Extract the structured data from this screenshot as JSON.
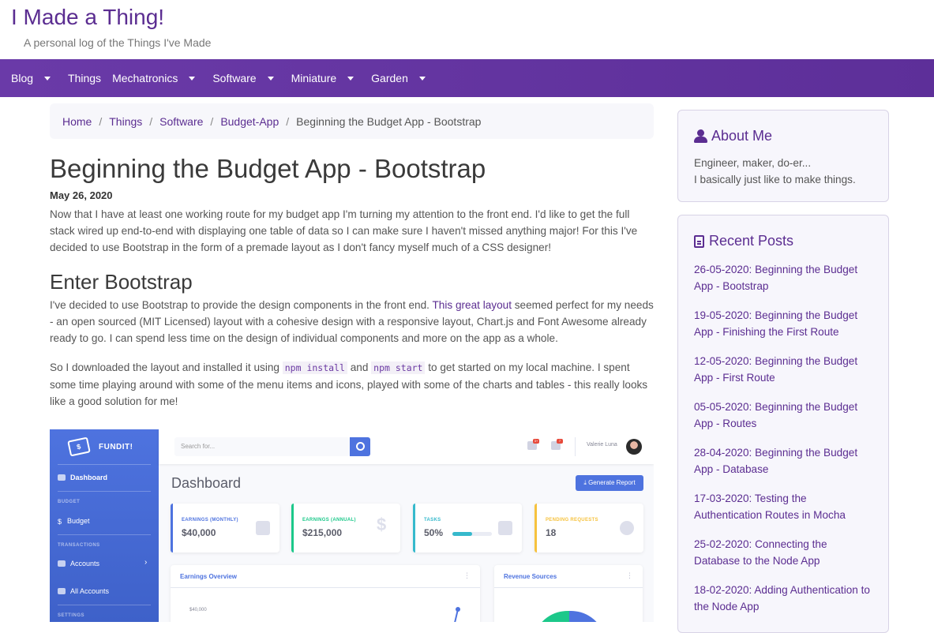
{
  "site": {
    "title": "I Made a Thing!",
    "tagline": "A personal log of the Things I've Made"
  },
  "nav": {
    "items": [
      {
        "label": "Blog",
        "dropdown": true
      },
      {
        "label": "Things",
        "dropdown": false
      },
      {
        "label": "Mechatronics",
        "dropdown": true
      },
      {
        "label": "Software",
        "dropdown": true
      },
      {
        "label": "Miniature",
        "dropdown": true
      },
      {
        "label": "Garden",
        "dropdown": true
      }
    ]
  },
  "breadcrumb": {
    "items": [
      "Home",
      "Things",
      "Software",
      "Budget-App"
    ],
    "current": "Beginning the Budget App - Bootstrap",
    "separator": "/"
  },
  "post": {
    "title": "Beginning the Budget App - Bootstrap",
    "date": "May 26, 2020",
    "intro": "Now that I have at least one working route for my budget app I'm turning my attention to the front end. I'd like to get the full stack wired up end-to-end with displaying one table of data so I can make sure I haven't missed anything major! For this I've decided to use Bootstrap in the form of a premade layout as I don't fancy myself much of a CSS designer!",
    "section_heading": "Enter Bootstrap",
    "p1_before": "I've decided to use Bootstrap to provide the design components in the front end. ",
    "p1_link": "This great layout",
    "p1_after": " seemed perfect for my needs - an open sourced (MIT Licensed) layout with a cohesive design with a responsive layout, Chart.js and Font Awesome already ready to go. I can spend less time on the design of individual components and more on the app as a whole.",
    "p2_a": "So I downloaded the layout and installed it using ",
    "p2_code1": "npm install",
    "p2_b": " and ",
    "p2_code2": "npm start",
    "p2_c": " to get started on my local machine. I spent some time playing around with some of the menu items and icons, played with some of the charts and tables - this really looks like a good solution for me!"
  },
  "screenshot": {
    "brand": "FUNDIT!",
    "sidebar": {
      "dashboard": "Dashboard",
      "sec_budget": "BUDGET",
      "budget": "Budget",
      "sec_transactions": "TRANSACTIONS",
      "accounts": "Accounts",
      "all_accounts": "All Accounts",
      "sec_settings": "SETTINGS"
    },
    "search_placeholder": "Search for...",
    "user": "Valerie Luna",
    "badge1": "3+",
    "badge2": "7",
    "page_title": "Dashboard",
    "report_button": "Generate Report",
    "cards": [
      {
        "label": "EARNINGS (MONTHLY)",
        "value": "$40,000",
        "color": "#4e73df"
      },
      {
        "label": "EARNINGS (ANNUAL)",
        "value": "$215,000",
        "color": "#1cc88a"
      },
      {
        "label": "TASKS",
        "value": "50%",
        "color": "#36b9cc",
        "progress": 0.5
      },
      {
        "label": "PENDING REQUESTS",
        "value": "18",
        "color": "#f6c23e"
      }
    ],
    "panel1_title": "Earnings Overview",
    "panel2_title": "Revenue Sources",
    "chart_label": "$40,000"
  },
  "sidebar": {
    "about_title": "About Me",
    "about_line1": "Engineer, maker, do-er...",
    "about_line2": "I basically just like to make things.",
    "recent_title": "Recent Posts",
    "recent": [
      {
        "date": "26-05-2020:",
        "title": "Beginning the Budget App - Bootstrap"
      },
      {
        "date": "19-05-2020:",
        "title": "Beginning the Budget App - Finishing the First Route"
      },
      {
        "date": "12-05-2020:",
        "title": "Beginning the Budget App - First Route"
      },
      {
        "date": "05-05-2020:",
        "title": "Beginning the Budget App - Routes"
      },
      {
        "date": "28-04-2020:",
        "title": "Beginning the Budget App - Database"
      },
      {
        "date": "17-03-2020:",
        "title": "Testing the Authentication Routes in Mocha"
      },
      {
        "date": "25-02-2020:",
        "title": "Connecting the Database to the Node App"
      },
      {
        "date": "18-02-2020:",
        "title": "Adding Authentication to the Node App"
      }
    ]
  },
  "colors": {
    "brand": "#5b2d91",
    "nav": "#6a3aa8",
    "link": "#5b2d91"
  }
}
